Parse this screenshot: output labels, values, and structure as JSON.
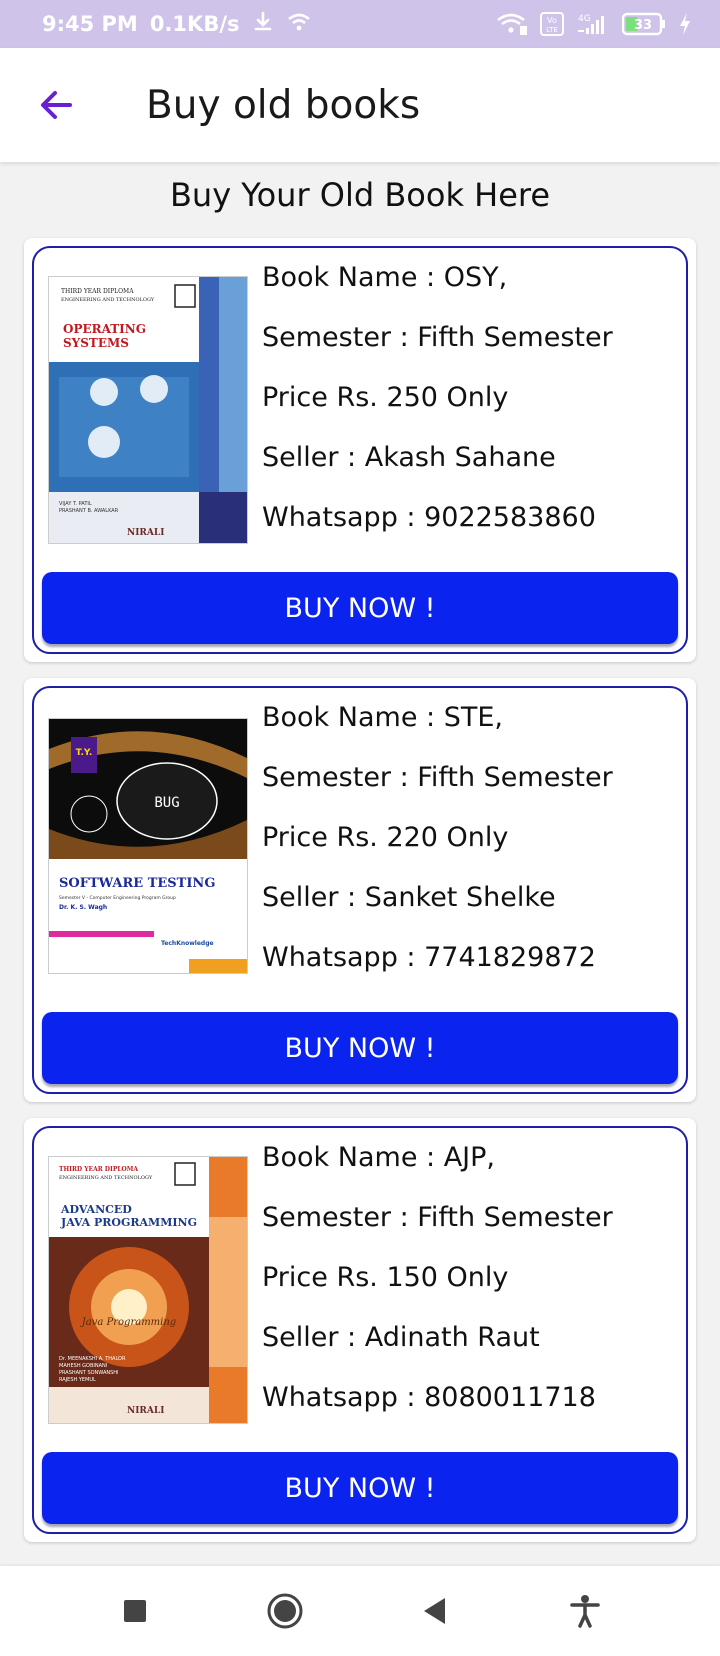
{
  "status_bar": {
    "time": "9:45 PM",
    "speed": "0.1KB/s",
    "battery": "33",
    "icons": [
      "download-icon",
      "wifi-icon",
      "wifi-calling-icon",
      "volte-icon",
      "signal-4g-icon",
      "battery-icon",
      "charging-icon"
    ]
  },
  "app_bar": {
    "title": "Buy old books",
    "back_icon": "arrow-back-icon",
    "accent_color": "#6a1fd6"
  },
  "heading": "Buy Your Old Book Here",
  "books": [
    {
      "name": "Book Name : OSY,",
      "semester": "Semester : Fifth Semester",
      "price": "Price Rs. 250 Only",
      "seller": "Seller : Akash Sahane",
      "whatsapp": "Whatsapp : 9022583860",
      "button": "BUY NOW !",
      "cover": {
        "top_line1": "THIRD YEAR DIPLOMA",
        "top_line2": "ENGINEERING AND TECHNOLOGY",
        "title1": "OPERATING",
        "title2": "SYSTEMS",
        "authors1": "VIJAY T. PATIL",
        "authors2": "PRASHANT B. AWALKAR",
        "publisher": "NIRALI"
      }
    },
    {
      "name": "Book Name : STE,",
      "semester": "Semester : Fifth Semester",
      "price": "Price Rs. 220 Only",
      "seller": "Seller : Sanket Shelke",
      "whatsapp": "Whatsapp : 7741829872",
      "button": "BUY NOW !",
      "cover": {
        "badge": "T.Y.",
        "bug": "BUG",
        "title1": "SOFTWARE TESTING",
        "subtitle": "Semester V - Computer Engineering Program Group",
        "author": "Dr. K. S. Wagh",
        "publisher": "TechKnowledge"
      }
    },
    {
      "name": "Book Name : AJP,",
      "semester": "Semester : Fifth Semester",
      "price": "Price Rs. 150 Only",
      "seller": "Seller : Adinath Raut",
      "whatsapp": "Whatsapp : 8080011718",
      "button": "BUY NOW !",
      "cover": {
        "top_line1": "THIRD YEAR DIPLOMA",
        "top_line2": "ENGINEERING AND TECHNOLOGY",
        "title1": "ADVANCED",
        "title2": "JAVA PROGRAMMING",
        "center_text": "Java Programming",
        "authors1": "Dr. MEENAKSHI A. THALOR",
        "authors2": "MAHESH GOBINANI",
        "authors3": "PRASHANT SONWANSHI",
        "authors4": "RAJESH YEMUL",
        "publisher": "NIRALI"
      }
    }
  ],
  "nav_bar": {
    "icons": [
      "recents-square-icon",
      "home-circle-icon",
      "back-triangle-icon",
      "accessibility-icon"
    ]
  },
  "colors": {
    "status_bar": "#cfc3ea",
    "button": "#0a23ee",
    "card_border": "#1e1ea8",
    "background": "#f2f2f2"
  }
}
